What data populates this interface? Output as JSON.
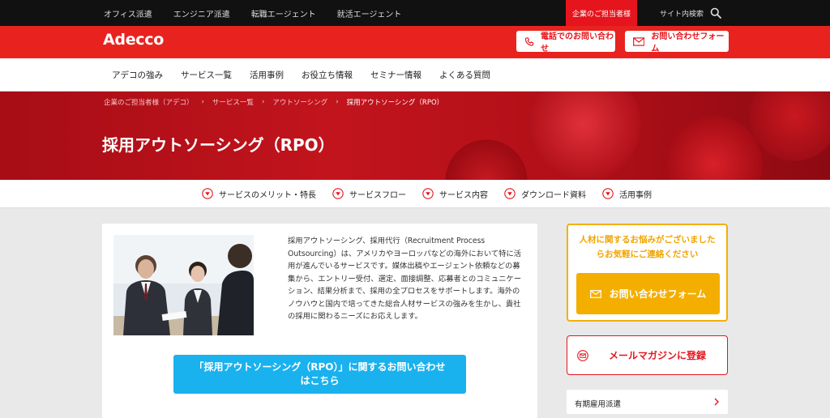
{
  "topbar": {
    "links": [
      "オフィス派遣",
      "エンジニア派遣",
      "転職エージェント",
      "就活エージェント"
    ],
    "corporate_label": "企業のご担当者様",
    "site_search_label": "サイト内検索"
  },
  "brand": {
    "logo_text": "Adecco",
    "phone_button": "電話でのお問い合わせ",
    "form_button": "お問い合わせフォーム"
  },
  "nav": {
    "items": [
      "アデコの強み",
      "サービス一覧",
      "活用事例",
      "お役立ち情報",
      "セミナー情報",
      "よくある質問"
    ]
  },
  "breadcrumb": {
    "items": [
      "企業のご担当者様（アデコ）",
      "サービス一覧",
      "アウトソーシング",
      "採用アウトソーシング（RPO）"
    ]
  },
  "page_title": "採用アウトソーシング（RPO）",
  "anchors": [
    "サービスのメリット・特長",
    "サービスフロー",
    "サービス内容",
    "ダウンロード資料",
    "活用事例"
  ],
  "main": {
    "description": "採用アウトソーシング、採用代行（Recruitment Process Outsourcing）は、アメリカやヨーロッパなどの海外において特に活用が進んでいるサービスです。媒体出稿やエージェント依頼などの募集から、エントリー受付、選定、面接調整、応募者とのコミュニケーション、結果分析まで、採用の全プロセスをサポートします。海外のノウハウと国内で培ってきた総合人材サービスの強みを生かし、貴社の採用に関わるニーズにお応えします。",
    "cta_line1": "「採用アウトソーシング（RPO）」に関するお問い合わせ",
    "cta_line2": "はこちら"
  },
  "sidebar": {
    "contact_msg_line1": "人材に関するお悩みがございました",
    "contact_msg_line2": "らお気軽にご連絡ください",
    "contact_form_button": "お問い合わせフォーム",
    "newsletter_button": "メールマガジンに登録",
    "list_item": "有期雇用派遣"
  },
  "colors": {
    "brand_red": "#e8231f",
    "accent_orange": "#f4ae00",
    "cta_blue": "#1ab1ef"
  }
}
